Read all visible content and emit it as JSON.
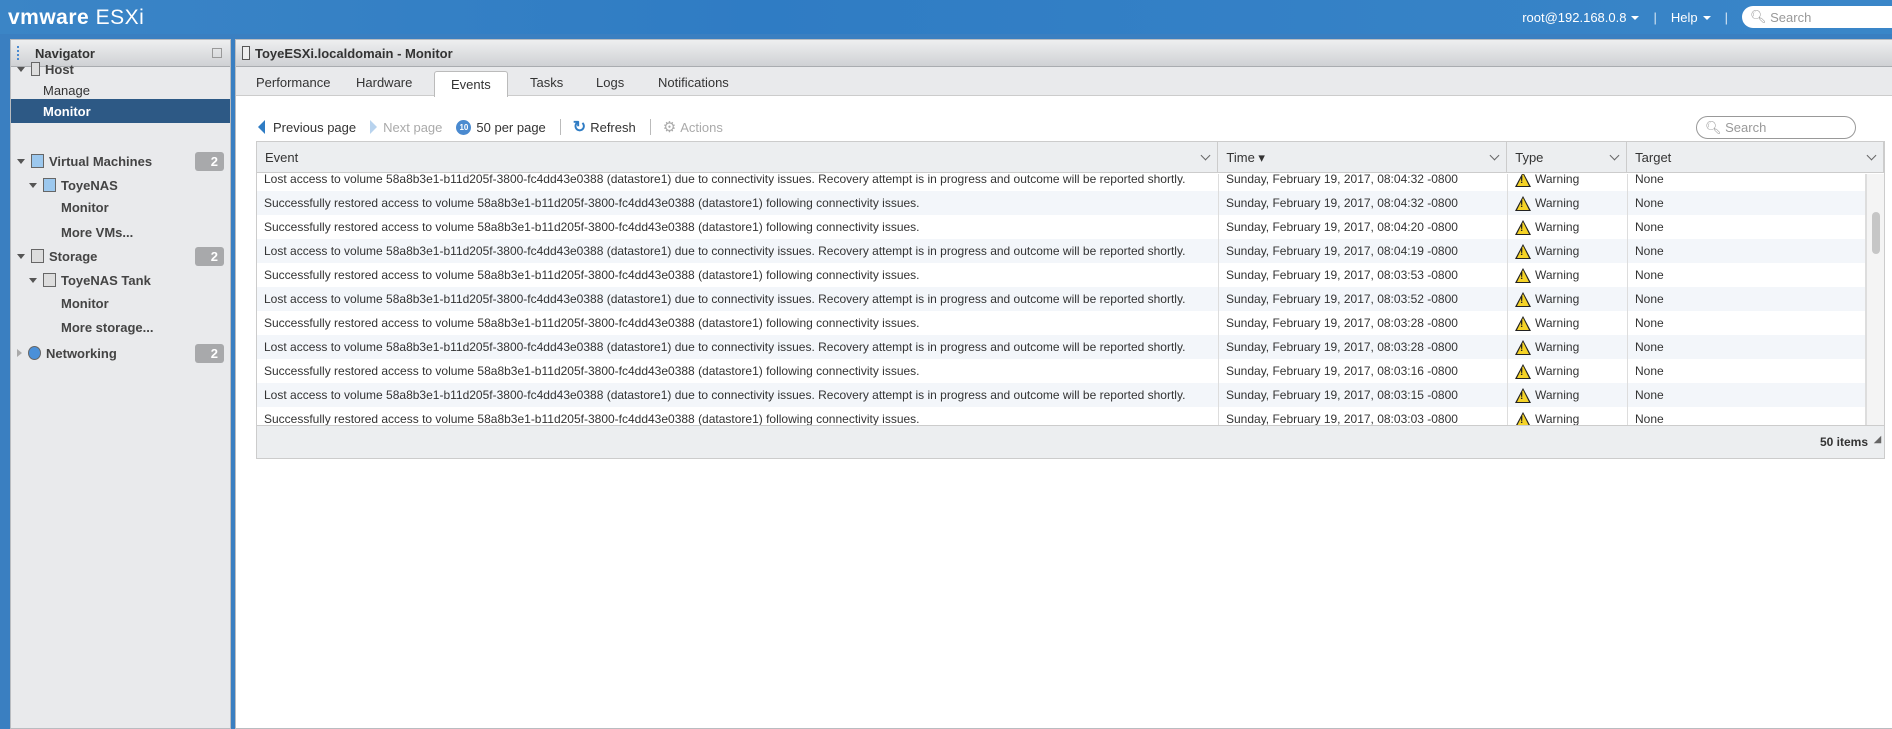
{
  "app": {
    "brand": "vmware",
    "product": "ESXi",
    "user": "root@192.168.0.8",
    "help": "Help",
    "search_placeholder": "Search"
  },
  "navigator": {
    "title": "Navigator",
    "items": [
      {
        "label": "Host",
        "badge": null
      },
      {
        "label": "Manage"
      },
      {
        "label": "Monitor",
        "selected": true
      },
      {
        "label": "Virtual Machines",
        "badge": "2"
      },
      {
        "label": "ToyeNAS"
      },
      {
        "label": "Monitor"
      },
      {
        "label": "More VMs..."
      },
      {
        "label": "Storage",
        "badge": "2"
      },
      {
        "label": "ToyeNAS Tank"
      },
      {
        "label": "Monitor"
      },
      {
        "label": "More storage..."
      },
      {
        "label": "Networking",
        "badge": "2"
      }
    ]
  },
  "main": {
    "title": "ToyeESXi.localdomain - Monitor",
    "tabs": [
      "Performance",
      "Hardware",
      "Events",
      "Tasks",
      "Logs",
      "Notifications"
    ],
    "active_tab": "Events",
    "toolbar": {
      "prev": "Previous page",
      "next": "Next page",
      "per_page_icon": "10",
      "per_page": "50 per page",
      "refresh": "Refresh",
      "actions": "Actions"
    },
    "search_placeholder": "Search",
    "columns": [
      "Event",
      "Time ▾",
      "Type",
      "Target"
    ],
    "rows": [
      [
        "Lost access to volume 58a8b3e1-b11d205f-3800-fc4dd43e0388 (datastore1) due to connectivity issues. Recovery attempt is in progress and outcome will be reported shortly.",
        "Sunday, February 19, 2017, 08:04:32 -0800",
        "Warning",
        "None"
      ],
      [
        "Successfully restored access to volume 58a8b3e1-b11d205f-3800-fc4dd43e0388 (datastore1) following connectivity issues.",
        "Sunday, February 19, 2017, 08:04:32 -0800",
        "Warning",
        "None"
      ],
      [
        "Successfully restored access to volume 58a8b3e1-b11d205f-3800-fc4dd43e0388 (datastore1) following connectivity issues.",
        "Sunday, February 19, 2017, 08:04:20 -0800",
        "Warning",
        "None"
      ],
      [
        "Lost access to volume 58a8b3e1-b11d205f-3800-fc4dd43e0388 (datastore1) due to connectivity issues. Recovery attempt is in progress and outcome will be reported shortly.",
        "Sunday, February 19, 2017, 08:04:19 -0800",
        "Warning",
        "None"
      ],
      [
        "Successfully restored access to volume 58a8b3e1-b11d205f-3800-fc4dd43e0388 (datastore1) following connectivity issues.",
        "Sunday, February 19, 2017, 08:03:53 -0800",
        "Warning",
        "None"
      ],
      [
        "Lost access to volume 58a8b3e1-b11d205f-3800-fc4dd43e0388 (datastore1) due to connectivity issues. Recovery attempt is in progress and outcome will be reported shortly.",
        "Sunday, February 19, 2017, 08:03:52 -0800",
        "Warning",
        "None"
      ],
      [
        "Successfully restored access to volume 58a8b3e1-b11d205f-3800-fc4dd43e0388 (datastore1) following connectivity issues.",
        "Sunday, February 19, 2017, 08:03:28 -0800",
        "Warning",
        "None"
      ],
      [
        "Lost access to volume 58a8b3e1-b11d205f-3800-fc4dd43e0388 (datastore1) due to connectivity issues. Recovery attempt is in progress and outcome will be reported shortly.",
        "Sunday, February 19, 2017, 08:03:28 -0800",
        "Warning",
        "None"
      ],
      [
        "Successfully restored access to volume 58a8b3e1-b11d205f-3800-fc4dd43e0388 (datastore1) following connectivity issues.",
        "Sunday, February 19, 2017, 08:03:16 -0800",
        "Warning",
        "None"
      ],
      [
        "Lost access to volume 58a8b3e1-b11d205f-3800-fc4dd43e0388 (datastore1) due to connectivity issues. Recovery attempt is in progress and outcome will be reported shortly.",
        "Sunday, February 19, 2017, 08:03:15 -0800",
        "Warning",
        "None"
      ],
      [
        "Successfully restored access to volume 58a8b3e1-b11d205f-3800-fc4dd43e0388 (datastore1) following connectivity issues.",
        "Sunday, February 19, 2017, 08:03:03 -0800",
        "Warning",
        "None"
      ]
    ],
    "footer": "50 items"
  },
  "colors": {
    "header": "#3381c4",
    "selected_nav": "#2d5985",
    "warning": "#f5d327"
  }
}
